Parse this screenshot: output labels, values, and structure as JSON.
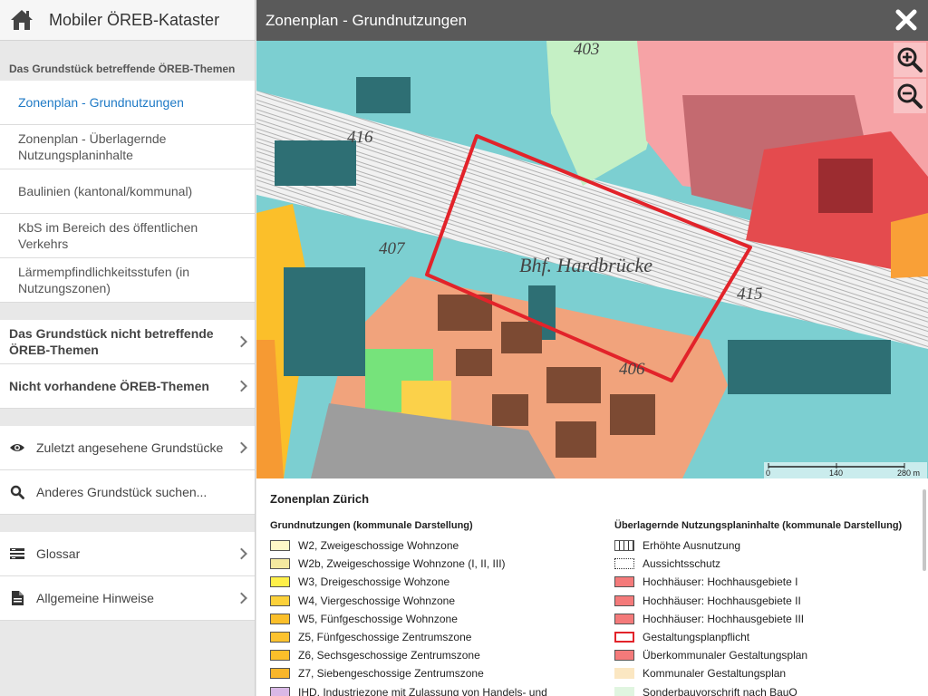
{
  "app": {
    "title": "Mobiler ÖREB-Kataster"
  },
  "sidebar": {
    "section_affecting": "Das Grundstück betreffende ÖREB-Themen",
    "items": [
      {
        "label": "Zonenplan - Grundnutzungen",
        "active": true
      },
      {
        "label": "Zonenplan - Überlagernde Nutzungsplaninhalte"
      },
      {
        "label": "Baulinien (kantonal/kommunal)"
      },
      {
        "label": "KbS im Bereich des öffentlichen Verkehrs"
      },
      {
        "label": "Lärmempfindlichkeitsstufen (in Nutzungszonen)"
      }
    ],
    "groups": [
      {
        "label": "Das Grundstück nicht betreffende ÖREB-Themen"
      },
      {
        "label": "Nicht vorhandene ÖREB-Themen"
      }
    ],
    "tools": [
      {
        "label": "Zuletzt angesehene Grundstücke",
        "icon": "eye-icon"
      },
      {
        "label": "Anderes Grundstück suchen...",
        "icon": "search-icon"
      }
    ],
    "info": [
      {
        "label": "Glossar",
        "icon": "list-icon"
      },
      {
        "label": "Allgemeine Hinweise",
        "icon": "document-icon"
      }
    ]
  },
  "main": {
    "title": "Zonenplan - Grundnutzungen",
    "map": {
      "labels": {
        "station": "Bhf. Hardbrücke",
        "n403": "403",
        "n416": "416",
        "n407": "407",
        "n415": "415",
        "n406": "406"
      },
      "scale": {
        "zero": "0",
        "mid": "140",
        "end": "280 m"
      }
    },
    "legend": {
      "title": "Zonenplan Zürich",
      "left_heading": "Grundnutzungen (kommunale Darstellung)",
      "left": [
        {
          "label": "W2, Zweigeschossige Wohnzone",
          "color": "#fff8c8"
        },
        {
          "label": "W2b, Zweigeschossige Wohnzone (I, II, III)",
          "color": "#f4e9a0"
        },
        {
          "label": "W3, Dreigeschossige Wohzone",
          "color": "#fff04a"
        },
        {
          "label": "W4, Viergeschossige Wohnzone",
          "color": "#fcd13a"
        },
        {
          "label": "W5, Fünfgeschossige Wohnzone",
          "color": "#fbbf2a"
        },
        {
          "label": "Z5, Fünfgeschossige Zentrumszone",
          "color": "#fbc22f"
        },
        {
          "label": "Z6, Sechsgeschossige Zentrumszone",
          "color": "#fbbf2a"
        },
        {
          "label": "Z7, Siebengeschossige Zentrumszone",
          "color": "#f9b62a"
        },
        {
          "label": "IHD, Industriezone mit Zulassung von Handels- und",
          "color": "#d9b8e6"
        }
      ],
      "right_heading": "Überlagernde Nutzungsplaninhalte (kommunale Darstellung)",
      "right": [
        {
          "label": "Erhöhte Ausnutzung",
          "color": "#ffffff",
          "pattern": "vlines"
        },
        {
          "label": "Aussichtsschutz",
          "color": "#ffffff",
          "pattern": "dotted"
        },
        {
          "label": "Hochhäuser: Hochhausgebiete I",
          "color": "#f47a7a"
        },
        {
          "label": "Hochhäuser: Hochhausgebiete II",
          "color": "#f47a7a"
        },
        {
          "label": "Hochhäuser: Hochhausgebiete III",
          "color": "#f47a7a"
        },
        {
          "label": "Gestaltungsplanpflicht",
          "color": "#ffffff",
          "pattern": "redborder"
        },
        {
          "label": "Überkommunaler Gestaltungsplan",
          "color": "#f47a7a"
        },
        {
          "label": "Kommunaler Gestaltungsplan",
          "color": "#fbe7c2",
          "pattern": "noborder"
        },
        {
          "label": "Sonderbauvorschrift nach BauO",
          "color": "#e0f5e0",
          "pattern": "noborder"
        }
      ]
    }
  }
}
